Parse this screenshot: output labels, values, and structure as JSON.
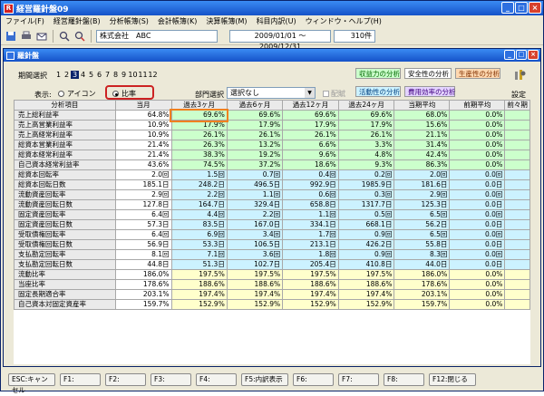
{
  "app": {
    "title": "経営羅針盤09",
    "icon_label": "R"
  },
  "menu": [
    "ファイル(F)",
    "経営羅針盤(B)",
    "分析帳簿(S)",
    "会計帳簿(K)",
    "決算帳簿(M)",
    "科目内訳(U)",
    "ウィンドウ・ヘルプ(H)"
  ],
  "toolbar": {
    "company": "株式会社　ABC",
    "period": "2009/01/01 ～ 2009/12/31",
    "count": "310件"
  },
  "inner": {
    "title": "羅針盤"
  },
  "controls": {
    "period_label": "期間選択",
    "periods": [
      "1",
      "2",
      "3",
      "4",
      "5",
      "6",
      "7",
      "8",
      "9",
      "10",
      "11",
      "12"
    ],
    "selected_period": "3",
    "display_label": "表示:",
    "radio_icon": "アイコン",
    "radio_ratio": "比率",
    "dept_label": "部門選択",
    "dept_value": "選択なし",
    "allocation_label": "配賦",
    "settings_label": "設定"
  },
  "analysis_buttons": {
    "profitability": "収益力の分析",
    "safety": "安全性の分析",
    "productivity": "生産性の分析",
    "activity": "活動性の分析",
    "cost_efficiency": "費用効率の分析"
  },
  "colors": {
    "accent": "#f08020",
    "green": "#ccffcc",
    "blue": "#ccf2ff",
    "yellow": "#ffffcc",
    "highlight": "#cc2222"
  },
  "table": {
    "headers": [
      "分析項目",
      "当月",
      "過去3ヶ月",
      "過去6ヶ月",
      "過去12ヶ月",
      "過去24ヶ月",
      "当期平均",
      "前期平均",
      "前々期"
    ],
    "rows": [
      {
        "name": "売上総利益率",
        "cells": [
          "64.8%",
          "69.6%",
          "69.6%",
          "69.6%",
          "69.6%",
          "68.0%",
          "0.0%",
          ""
        ],
        "group": "green"
      },
      {
        "name": "売上高営業利益率",
        "cells": [
          "10.9%",
          "17.9%",
          "17.9%",
          "17.9%",
          "17.9%",
          "15.6%",
          "0.0%",
          ""
        ],
        "group": "green"
      },
      {
        "name": "売上高経常利益率",
        "cells": [
          "10.9%",
          "26.1%",
          "26.1%",
          "26.1%",
          "26.1%",
          "21.1%",
          "0.0%",
          ""
        ],
        "group": "green"
      },
      {
        "name": "総資本営業利益率",
        "cells": [
          "21.4%",
          "26.3%",
          "13.2%",
          "6.6%",
          "3.3%",
          "31.4%",
          "0.0%",
          ""
        ],
        "group": "green"
      },
      {
        "name": "総資本経常利益率",
        "cells": [
          "21.4%",
          "38.3%",
          "19.2%",
          "9.6%",
          "4.8%",
          "42.4%",
          "0.0%",
          ""
        ],
        "group": "green"
      },
      {
        "name": "自己資本経常利益率",
        "cells": [
          "43.6%",
          "74.5%",
          "37.2%",
          "18.6%",
          "9.3%",
          "86.3%",
          "0.0%",
          ""
        ],
        "group": "green"
      },
      {
        "name": "総資本回転率",
        "cells": [
          "2.0回",
          "1.5回",
          "0.7回",
          "0.4回",
          "0.2回",
          "2.0回",
          "0.0回",
          ""
        ],
        "group": "blue"
      },
      {
        "name": "総資本回転日数",
        "cells": [
          "185.1日",
          "248.2日",
          "496.5日",
          "992.9日",
          "1985.9日",
          "181.6日",
          "0.0日",
          ""
        ],
        "group": "blue"
      },
      {
        "name": "流動資産回転率",
        "cells": [
          "2.9回",
          "2.2回",
          "1.1回",
          "0.6回",
          "0.3回",
          "2.9回",
          "0.0回",
          ""
        ],
        "group": "blue"
      },
      {
        "name": "流動資産回転日数",
        "cells": [
          "127.8日",
          "164.7日",
          "329.4日",
          "658.8日",
          "1317.7日",
          "125.3日",
          "0.0日",
          ""
        ],
        "group": "blue"
      },
      {
        "name": "固定資産回転率",
        "cells": [
          "6.4回",
          "4.4回",
          "2.2回",
          "1.1回",
          "0.5回",
          "6.5回",
          "0.0回",
          ""
        ],
        "group": "blue"
      },
      {
        "name": "固定資産回転日数",
        "cells": [
          "57.3日",
          "83.5日",
          "167.0日",
          "334.1日",
          "668.1日",
          "56.2日",
          "0.0日",
          ""
        ],
        "group": "blue"
      },
      {
        "name": "受取債権回転率",
        "cells": [
          "6.4回",
          "6.9回",
          "3.4回",
          "1.7回",
          "0.9回",
          "6.5回",
          "0.0回",
          ""
        ],
        "group": "blue"
      },
      {
        "name": "受取債権回転日数",
        "cells": [
          "56.9日",
          "53.3日",
          "106.5日",
          "213.1日",
          "426.2日",
          "55.8日",
          "0.0日",
          ""
        ],
        "group": "blue"
      },
      {
        "name": "支払勘定回転率",
        "cells": [
          "8.1回",
          "7.1回",
          "3.6回",
          "1.8回",
          "0.9回",
          "8.3回",
          "0.0回",
          ""
        ],
        "group": "blue"
      },
      {
        "name": "支払勘定回転日数",
        "cells": [
          "44.8日",
          "51.3日",
          "102.7日",
          "205.4日",
          "410.8日",
          "44.0日",
          "0.0日",
          ""
        ],
        "group": "blue"
      },
      {
        "name": "流動比率",
        "cells": [
          "186.0%",
          "197.5%",
          "197.5%",
          "197.5%",
          "197.5%",
          "186.0%",
          "0.0%",
          ""
        ],
        "group": "yellow"
      },
      {
        "name": "当座比率",
        "cells": [
          "178.6%",
          "188.6%",
          "188.6%",
          "188.6%",
          "188.6%",
          "178.6%",
          "0.0%",
          ""
        ],
        "group": "yellow"
      },
      {
        "name": "固定長期適合率",
        "cells": [
          "203.1%",
          "197.4%",
          "197.4%",
          "197.4%",
          "197.4%",
          "203.1%",
          "0.0%",
          ""
        ],
        "group": "yellow"
      },
      {
        "name": "自己資本対固定資産率",
        "cells": [
          "159.7%",
          "152.9%",
          "152.9%",
          "152.9%",
          "152.9%",
          "159.7%",
          "0.0%",
          ""
        ],
        "group": "yellow"
      }
    ]
  },
  "fkeys": [
    "ESC:キャンセル",
    "F1:",
    "F2:",
    "F3:",
    "F4:",
    "F5:内訳表示",
    "F6:",
    "F7:",
    "F8:",
    "F12:閉じる"
  ]
}
